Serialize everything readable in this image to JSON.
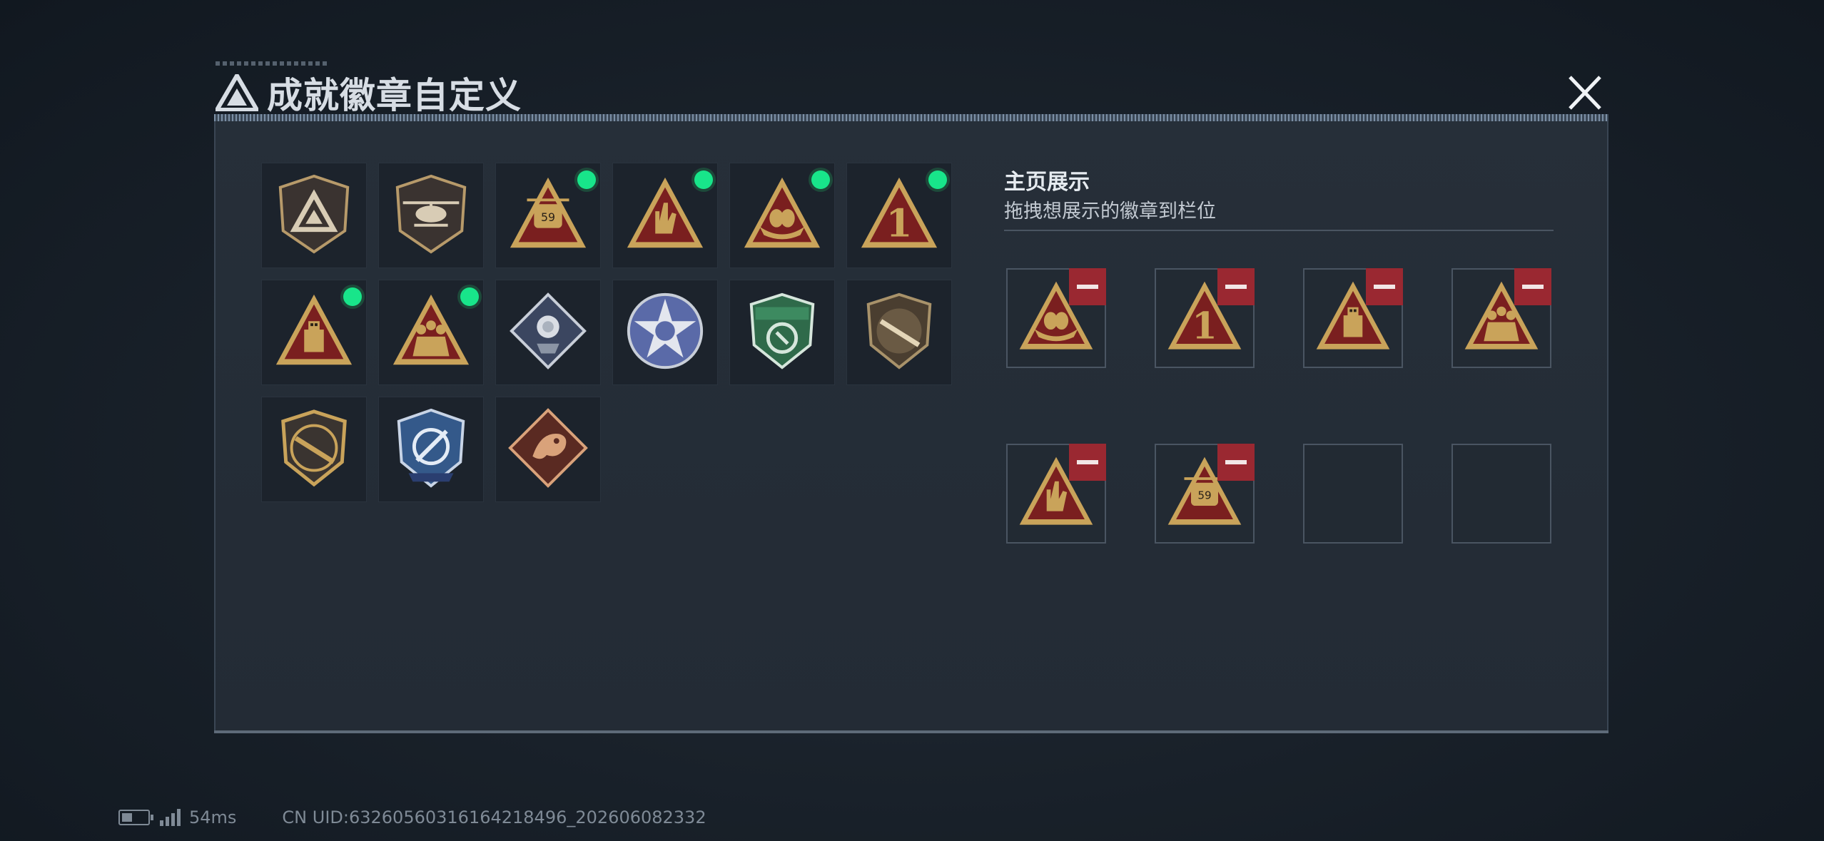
{
  "window": {
    "title": "成就徽章自定义",
    "close_icon": "close-icon"
  },
  "collection": {
    "badges": [
      {
        "icon": "shield-triangle-badge-icon",
        "new": false
      },
      {
        "icon": "helicopter-badge-icon",
        "new": false
      },
      {
        "icon": "helicopter-59-badge-icon",
        "new": true
      },
      {
        "icon": "hand-sign-badge-icon",
        "new": true
      },
      {
        "icon": "nest-eggs-badge-icon",
        "new": true
      },
      {
        "icon": "number-one-badge-icon",
        "new": true
      },
      {
        "icon": "usb-drive-badge-icon",
        "new": true
      },
      {
        "icon": "squad-soldiers-badge-icon",
        "new": true
      },
      {
        "icon": "rose-diamond-badge-icon",
        "new": false
      },
      {
        "icon": "star-skull-badge-icon",
        "new": false
      },
      {
        "icon": "green-shield-badge-icon",
        "new": false
      },
      {
        "icon": "rifle-shield-badge-icon",
        "new": false
      },
      {
        "icon": "gold-rifle-badge-icon",
        "new": false
      },
      {
        "icon": "crosshair-knife-badge-icon",
        "new": false
      },
      {
        "icon": "dragon-diamond-badge-icon",
        "new": false
      }
    ]
  },
  "showcase": {
    "title": "主页展示",
    "hint": "拖拽想展示的徽章到栏位",
    "slots": [
      {
        "icon": "nest-eggs-badge-icon",
        "removable": true
      },
      {
        "icon": "number-one-badge-icon",
        "removable": true
      },
      {
        "icon": "usb-drive-badge-icon",
        "removable": true
      },
      {
        "icon": "squad-soldiers-badge-icon",
        "removable": true
      },
      {
        "icon": "hand-sign-badge-icon",
        "removable": true
      },
      {
        "icon": "helicopter-59-badge-icon",
        "removable": true
      },
      {
        "icon": "",
        "removable": false
      },
      {
        "icon": "",
        "removable": false
      }
    ]
  },
  "status_bar": {
    "ping": "54ms",
    "uid": "CN UID:6326056031616421849​6_202606082332"
  },
  "colors": {
    "accent_gold": "#c9a35a",
    "badge_red": "#7a1f1f",
    "new_dot": "#18e58a",
    "remove_red": "#9a2831"
  }
}
